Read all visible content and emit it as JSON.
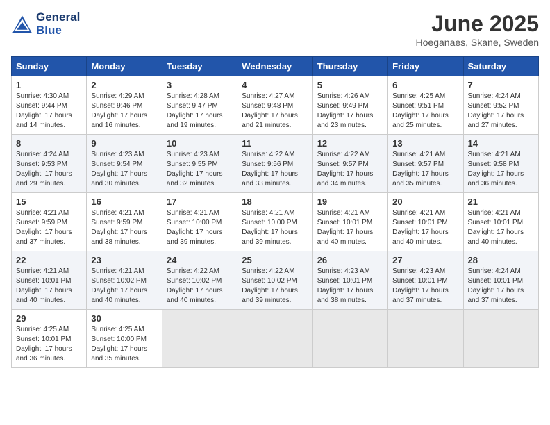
{
  "header": {
    "logo_line1": "General",
    "logo_line2": "Blue",
    "month": "June 2025",
    "location": "Hoeganaes, Skane, Sweden"
  },
  "weekdays": [
    "Sunday",
    "Monday",
    "Tuesday",
    "Wednesday",
    "Thursday",
    "Friday",
    "Saturday"
  ],
  "weeks": [
    [
      {
        "day": "1",
        "sunrise": "Sunrise: 4:30 AM",
        "sunset": "Sunset: 9:44 PM",
        "daylight": "Daylight: 17 hours and 14 minutes."
      },
      {
        "day": "2",
        "sunrise": "Sunrise: 4:29 AM",
        "sunset": "Sunset: 9:46 PM",
        "daylight": "Daylight: 17 hours and 16 minutes."
      },
      {
        "day": "3",
        "sunrise": "Sunrise: 4:28 AM",
        "sunset": "Sunset: 9:47 PM",
        "daylight": "Daylight: 17 hours and 19 minutes."
      },
      {
        "day": "4",
        "sunrise": "Sunrise: 4:27 AM",
        "sunset": "Sunset: 9:48 PM",
        "daylight": "Daylight: 17 hours and 21 minutes."
      },
      {
        "day": "5",
        "sunrise": "Sunrise: 4:26 AM",
        "sunset": "Sunset: 9:49 PM",
        "daylight": "Daylight: 17 hours and 23 minutes."
      },
      {
        "day": "6",
        "sunrise": "Sunrise: 4:25 AM",
        "sunset": "Sunset: 9:51 PM",
        "daylight": "Daylight: 17 hours and 25 minutes."
      },
      {
        "day": "7",
        "sunrise": "Sunrise: 4:24 AM",
        "sunset": "Sunset: 9:52 PM",
        "daylight": "Daylight: 17 hours and 27 minutes."
      }
    ],
    [
      {
        "day": "8",
        "sunrise": "Sunrise: 4:24 AM",
        "sunset": "Sunset: 9:53 PM",
        "daylight": "Daylight: 17 hours and 29 minutes."
      },
      {
        "day": "9",
        "sunrise": "Sunrise: 4:23 AM",
        "sunset": "Sunset: 9:54 PM",
        "daylight": "Daylight: 17 hours and 30 minutes."
      },
      {
        "day": "10",
        "sunrise": "Sunrise: 4:23 AM",
        "sunset": "Sunset: 9:55 PM",
        "daylight": "Daylight: 17 hours and 32 minutes."
      },
      {
        "day": "11",
        "sunrise": "Sunrise: 4:22 AM",
        "sunset": "Sunset: 9:56 PM",
        "daylight": "Daylight: 17 hours and 33 minutes."
      },
      {
        "day": "12",
        "sunrise": "Sunrise: 4:22 AM",
        "sunset": "Sunset: 9:57 PM",
        "daylight": "Daylight: 17 hours and 34 minutes."
      },
      {
        "day": "13",
        "sunrise": "Sunrise: 4:21 AM",
        "sunset": "Sunset: 9:57 PM",
        "daylight": "Daylight: 17 hours and 35 minutes."
      },
      {
        "day": "14",
        "sunrise": "Sunrise: 4:21 AM",
        "sunset": "Sunset: 9:58 PM",
        "daylight": "Daylight: 17 hours and 36 minutes."
      }
    ],
    [
      {
        "day": "15",
        "sunrise": "Sunrise: 4:21 AM",
        "sunset": "Sunset: 9:59 PM",
        "daylight": "Daylight: 17 hours and 37 minutes."
      },
      {
        "day": "16",
        "sunrise": "Sunrise: 4:21 AM",
        "sunset": "Sunset: 9:59 PM",
        "daylight": "Daylight: 17 hours and 38 minutes."
      },
      {
        "day": "17",
        "sunrise": "Sunrise: 4:21 AM",
        "sunset": "Sunset: 10:00 PM",
        "daylight": "Daylight: 17 hours and 39 minutes."
      },
      {
        "day": "18",
        "sunrise": "Sunrise: 4:21 AM",
        "sunset": "Sunset: 10:00 PM",
        "daylight": "Daylight: 17 hours and 39 minutes."
      },
      {
        "day": "19",
        "sunrise": "Sunrise: 4:21 AM",
        "sunset": "Sunset: 10:01 PM",
        "daylight": "Daylight: 17 hours and 40 minutes."
      },
      {
        "day": "20",
        "sunrise": "Sunrise: 4:21 AM",
        "sunset": "Sunset: 10:01 PM",
        "daylight": "Daylight: 17 hours and 40 minutes."
      },
      {
        "day": "21",
        "sunrise": "Sunrise: 4:21 AM",
        "sunset": "Sunset: 10:01 PM",
        "daylight": "Daylight: 17 hours and 40 minutes."
      }
    ],
    [
      {
        "day": "22",
        "sunrise": "Sunrise: 4:21 AM",
        "sunset": "Sunset: 10:01 PM",
        "daylight": "Daylight: 17 hours and 40 minutes."
      },
      {
        "day": "23",
        "sunrise": "Sunrise: 4:21 AM",
        "sunset": "Sunset: 10:02 PM",
        "daylight": "Daylight: 17 hours and 40 minutes."
      },
      {
        "day": "24",
        "sunrise": "Sunrise: 4:22 AM",
        "sunset": "Sunset: 10:02 PM",
        "daylight": "Daylight: 17 hours and 40 minutes."
      },
      {
        "day": "25",
        "sunrise": "Sunrise: 4:22 AM",
        "sunset": "Sunset: 10:02 PM",
        "daylight": "Daylight: 17 hours and 39 minutes."
      },
      {
        "day": "26",
        "sunrise": "Sunrise: 4:23 AM",
        "sunset": "Sunset: 10:01 PM",
        "daylight": "Daylight: 17 hours and 38 minutes."
      },
      {
        "day": "27",
        "sunrise": "Sunrise: 4:23 AM",
        "sunset": "Sunset: 10:01 PM",
        "daylight": "Daylight: 17 hours and 37 minutes."
      },
      {
        "day": "28",
        "sunrise": "Sunrise: 4:24 AM",
        "sunset": "Sunset: 10:01 PM",
        "daylight": "Daylight: 17 hours and 37 minutes."
      }
    ],
    [
      {
        "day": "29",
        "sunrise": "Sunrise: 4:25 AM",
        "sunset": "Sunset: 10:01 PM",
        "daylight": "Daylight: 17 hours and 36 minutes."
      },
      {
        "day": "30",
        "sunrise": "Sunrise: 4:25 AM",
        "sunset": "Sunset: 10:00 PM",
        "daylight": "Daylight: 17 hours and 35 minutes."
      },
      null,
      null,
      null,
      null,
      null
    ]
  ]
}
